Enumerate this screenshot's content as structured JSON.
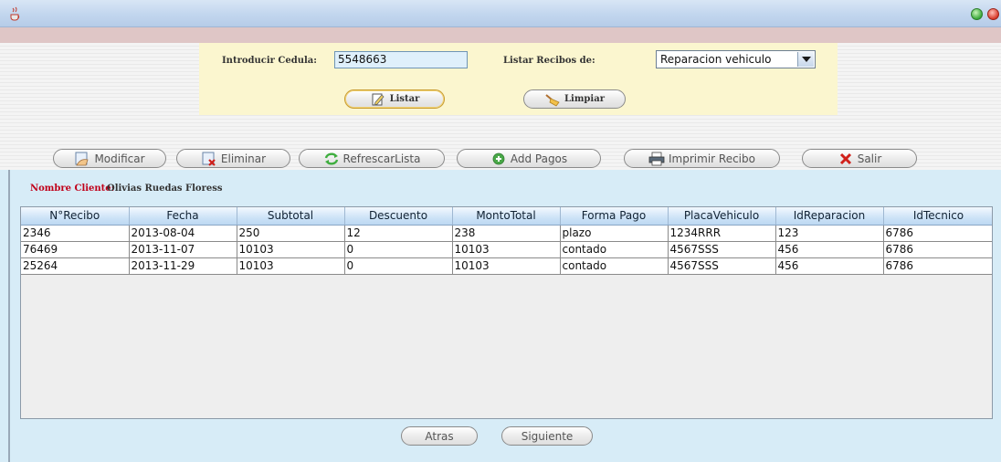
{
  "window": {
    "app_icon": "java-coffee-icon",
    "buttons": [
      "maximize-green",
      "close-red"
    ]
  },
  "search": {
    "cedula_label": "Introducir Cedula:",
    "cedula_value": "5548663",
    "recibos_label": "Listar Recibos de:",
    "tipo_selected": "Reparacion vehiculo",
    "listar_label": "Listar",
    "limpiar_label": "Limpiar"
  },
  "toolbar": {
    "modificar": "Modificar",
    "eliminar": "Eliminar",
    "refrescar": "RefrescarLista",
    "add_pagos": "Add Pagos",
    "imprimir": "Imprimir Recibo",
    "salir": "Salir"
  },
  "cliente": {
    "label": "Nombre Cliente:",
    "name": "Olivias Ruedas Floress"
  },
  "table": {
    "headers": [
      "N°Recibo",
      "Fecha",
      "Subtotal",
      "Descuento",
      "MontoTotal",
      "Forma Pago",
      "PlacaVehiculo",
      "IdReparacion",
      "IdTecnico"
    ],
    "rows": [
      [
        "2346",
        "2013-08-04",
        "250",
        "12",
        "238",
        "plazo",
        "1234RRR",
        "123",
        "6786"
      ],
      [
        "76469",
        "2013-11-07",
        "10103",
        "0",
        "10103",
        "contado",
        "4567SSS",
        "456",
        "6786"
      ],
      [
        "25264",
        "2013-11-29",
        "10103",
        "0",
        "10103",
        "contado",
        "4567SSS",
        "456",
        "6786"
      ]
    ]
  },
  "pager": {
    "atras": "Atras",
    "siguiente": "Siguiente"
  },
  "colors": {
    "search_panel": "#fbf6cf",
    "main_panel": "#d7ecf7",
    "cliente_label": "#c0001a"
  }
}
